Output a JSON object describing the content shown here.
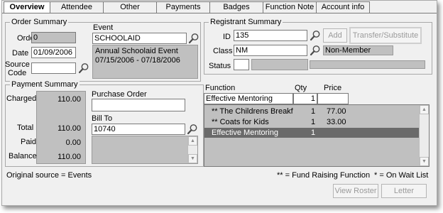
{
  "tabs": [
    "Overview",
    "Attendee",
    "Other",
    "Payments",
    "Badges",
    "Function Note",
    "Account info"
  ],
  "order_summary": {
    "title": "Order Summary",
    "order_label": "Order",
    "order_value": "0",
    "date_label": "Date",
    "date_value": "01/09/2006",
    "source_label_1": "Source",
    "source_label_2": "Code",
    "source_value": "",
    "event_label": "Event",
    "event_value": "SCHOOLAID",
    "event_desc_1": "Annual Schoolaid Event",
    "event_desc_2": "07/15/2006 - 07/18/2006"
  },
  "registrant_summary": {
    "title": "Registrant Summary",
    "id_label": "ID",
    "id_value": "135",
    "add_label": "Add",
    "transfer_label": "Transfer/Substitute",
    "class_label": "Class",
    "class_value": "NM",
    "class_desc": "Non-Member",
    "status_label": "Status",
    "status_value": ""
  },
  "payment_summary": {
    "title": "Payment Summary",
    "charged_label": "Charged",
    "charged_value": "110.00",
    "total_label": "Total",
    "total_value": "110.00",
    "paid_label": "Paid",
    "paid_value": "0.00",
    "balance_label": "Balance",
    "balance_value": "110.00",
    "po_label": "Purchase Order",
    "po_value": "",
    "billto_label": "Bill To",
    "billto_value": "10740"
  },
  "functions": {
    "function_header": "Function",
    "qty_header": "Qty",
    "price_header": "Price",
    "input_function": "Effective Mentoring",
    "input_qty": "1",
    "input_price": "",
    "rows": [
      {
        "name": "** The Childrens Breakf",
        "qty": "1",
        "price": "77.00"
      },
      {
        "name": "** Coats for Kids",
        "qty": "1",
        "price": "33.00"
      },
      {
        "name": "Effective Mentoring",
        "qty": "1",
        "price": ""
      }
    ]
  },
  "footer": {
    "original_source": "Original source = Events",
    "legend_fund": "** = Fund Raising Function",
    "legend_wait": "* = On Wait List",
    "view_roster_label": "View Roster",
    "letter_label": "Letter"
  },
  "icons": {
    "lookup": "magnifier-icon",
    "scroll_up": "scroll-up-arrow-icon",
    "scroll_down": "scroll-down-arrow-icon"
  },
  "colors": {
    "window_bg": "#f0f0f0",
    "readonly_bg": "#c0c0c0",
    "selected_row": "#6a6a6a"
  }
}
